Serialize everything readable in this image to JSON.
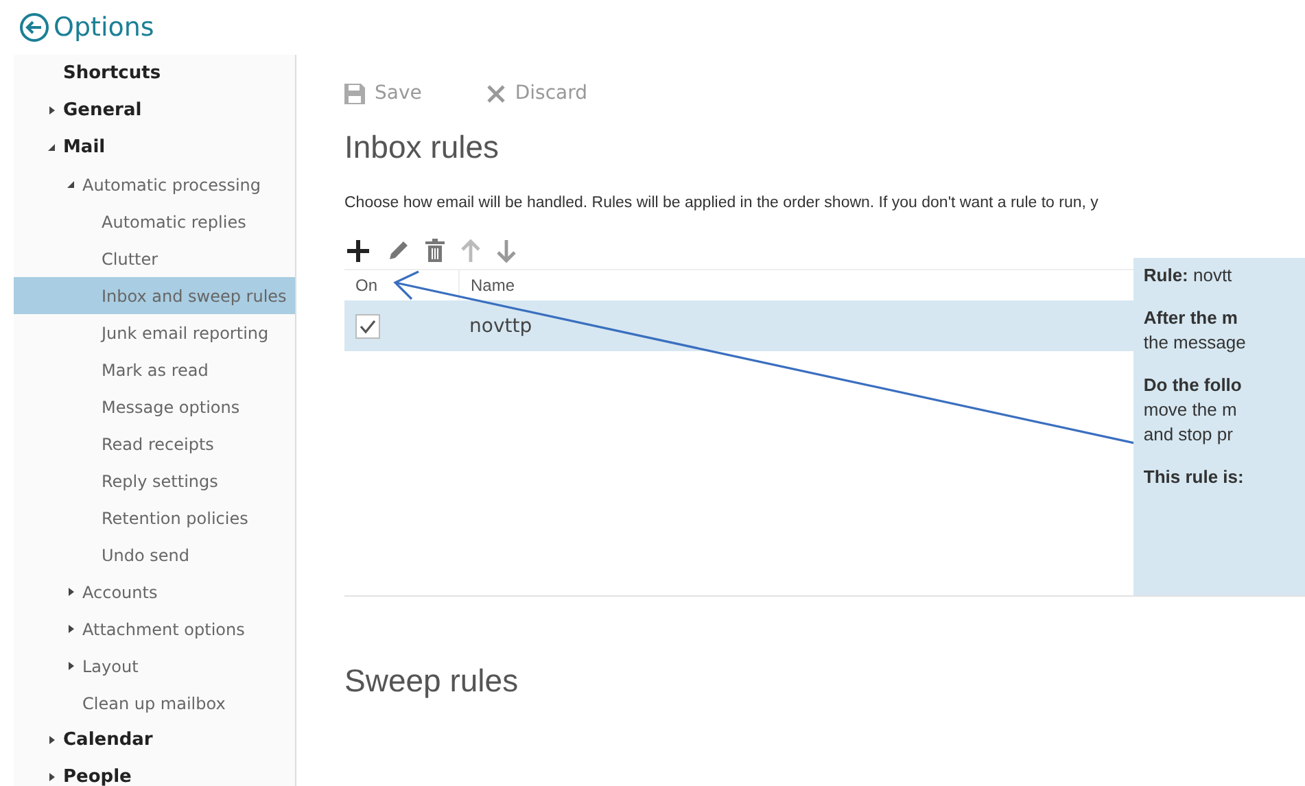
{
  "header": {
    "title": "Options"
  },
  "sidebar": {
    "items": [
      {
        "label": "Shortcuts",
        "selected": false
      },
      {
        "label": "General",
        "selected": false,
        "expanded": false
      },
      {
        "label": "Mail",
        "selected": false,
        "expanded": true,
        "children": [
          {
            "label": "Automatic processing",
            "selected": false,
            "expanded": true,
            "children": [
              {
                "label": "Automatic replies",
                "selected": false
              },
              {
                "label": "Clutter",
                "selected": false
              },
              {
                "label": "Inbox and sweep rules",
                "selected": true
              },
              {
                "label": "Junk email reporting",
                "selected": false
              },
              {
                "label": "Mark as read",
                "selected": false
              },
              {
                "label": "Message options",
                "selected": false
              },
              {
                "label": "Read receipts",
                "selected": false
              },
              {
                "label": "Reply settings",
                "selected": false
              },
              {
                "label": "Retention policies",
                "selected": false
              },
              {
                "label": "Undo send",
                "selected": false
              }
            ]
          },
          {
            "label": "Accounts",
            "selected": false,
            "expanded": false
          },
          {
            "label": "Attachment options",
            "selected": false,
            "expanded": false
          },
          {
            "label": "Layout",
            "selected": false,
            "expanded": false
          },
          {
            "label": "Clean up mailbox",
            "selected": false
          }
        ]
      },
      {
        "label": "Calendar",
        "selected": false,
        "expanded": false
      },
      {
        "label": "People",
        "selected": false,
        "expanded": false
      }
    ]
  },
  "toolbar": {
    "save": "Save",
    "discard": "Discard"
  },
  "inbox_rules": {
    "title": "Inbox rules",
    "description": "Choose how email will be handled. Rules will be applied in the order shown. If you don't want a rule to run, y",
    "columns": [
      "On",
      "Name"
    ],
    "rows": [
      {
        "on": true,
        "name": "novttp",
        "selected": true
      }
    ],
    "details": [
      "**Rule:** novtt",
      "**After the m**",
      "the message",
      "**Do the follo**",
      "move the m",
      "and stop pr",
      "**This rule is:**"
    ]
  },
  "sweep_rules": {
    "title": "Sweep rules"
  }
}
